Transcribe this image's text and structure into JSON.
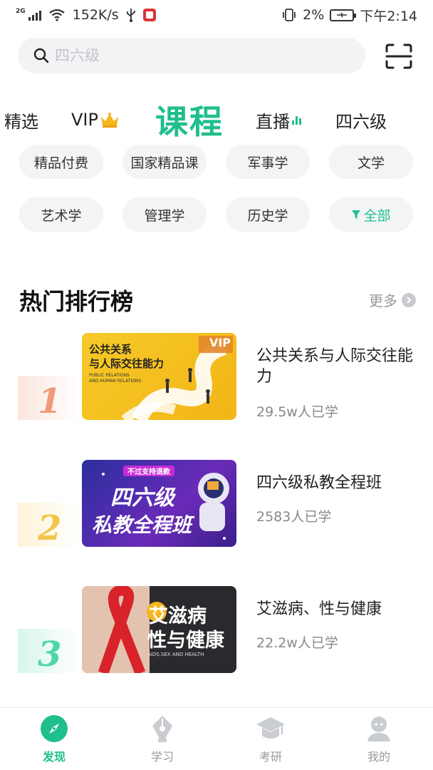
{
  "status_bar": {
    "network": "2G",
    "speed": "152K/s",
    "battery": "2%",
    "time": "下午2:14"
  },
  "search": {
    "placeholder": "四六级"
  },
  "tabs": [
    {
      "label": "精选"
    },
    {
      "label": "VIP"
    },
    {
      "label": "课程"
    },
    {
      "label": "直播"
    },
    {
      "label": "四六级"
    }
  ],
  "active_tab": "课程",
  "categories": [
    {
      "label": "精品付费"
    },
    {
      "label": "国家精品课"
    },
    {
      "label": "军事学"
    },
    {
      "label": "文学"
    },
    {
      "label": "艺术学"
    },
    {
      "label": "管理学"
    },
    {
      "label": "历史学"
    },
    {
      "label": "全部"
    }
  ],
  "ranking": {
    "title": "热门排行榜",
    "more_label": "更多",
    "items": [
      {
        "rank": "1",
        "title": "公共关系与人际交往能力",
        "learners": "29.5w人已学",
        "thumb_title_line1": "公共关系",
        "thumb_title_line2": "与人际交往能力",
        "thumb_subtitle_line1": "PUBLIC RELATIONS",
        "thumb_subtitle_line2": "AND HUMAN RELATIONS",
        "thumb_badge": "VIP"
      },
      {
        "rank": "2",
        "title": "四六级私教全程班",
        "learners": "2583人已学",
        "thumb_tag": "不过支持退款",
        "thumb_title_line1": "四六级",
        "thumb_title_line2": "私教全程班"
      },
      {
        "rank": "3",
        "title": "艾滋病、性与健康",
        "learners": "22.2w人已学",
        "thumb_title_line1": "艾滋病",
        "thumb_title_line2": "性与健康",
        "thumb_subtitle_line1": "AIDS,SEX AND HEALTH"
      }
    ]
  },
  "bottom_nav": [
    {
      "label": "发现",
      "icon": "compass-icon"
    },
    {
      "label": "学习",
      "icon": "pen-nib-icon"
    },
    {
      "label": "考研",
      "icon": "graduation-cap-icon"
    },
    {
      "label": "我的",
      "icon": "user-icon"
    }
  ],
  "colors": {
    "accent": "#1fbf8d",
    "chip_bg": "#f3f4f6",
    "muted": "#888888"
  }
}
